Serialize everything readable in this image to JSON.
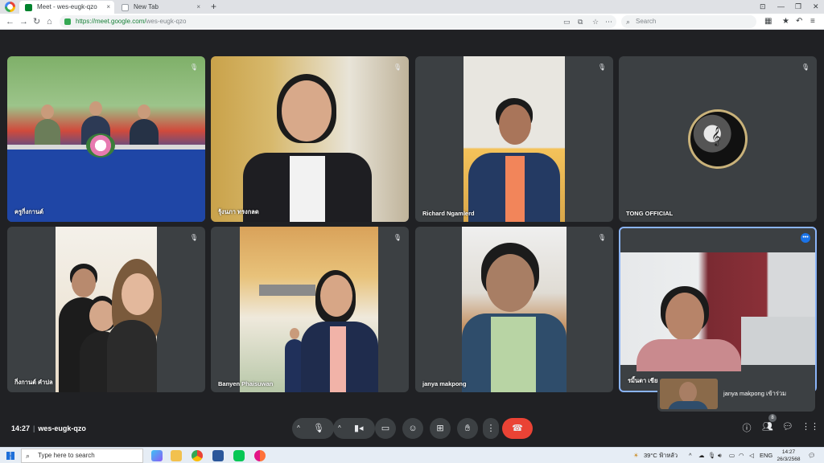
{
  "browser": {
    "tabs": [
      {
        "title": "Meet - wes-eugk-qzo",
        "close": "×"
      },
      {
        "title": "New Tab",
        "close": "×"
      }
    ],
    "new_tab": "+",
    "url_host": "https://meet.google.com/",
    "url_path": "wes-eugk-qzo",
    "search_placeholder": "Search"
  },
  "participants": [
    {
      "name": "ครูกิ่งกานต์",
      "muted": true
    },
    {
      "name": "รุ้งนภา ทรงกลด",
      "muted": true
    },
    {
      "name": "Richard Ngamlerd",
      "muted": true
    },
    {
      "name": "TONG OFFICIAL",
      "muted": true
    },
    {
      "name": "กิ่งกานต์ คำปล",
      "muted": true
    },
    {
      "name": "Banyen Phaisuwan",
      "muted": true
    },
    {
      "name": "janya makpong",
      "muted": true
    },
    {
      "name": "รมิ้นตา เขียวอ่",
      "muted": false
    }
  ],
  "toast": {
    "text": "janya makpong เข้าร่วม"
  },
  "meeting": {
    "time": "14:27",
    "code": "wes-eugk-qzo",
    "people_count": "8"
  },
  "taskbar": {
    "search_placeholder": "Type here to search",
    "weather": "39°C  ฟ้าหลัว",
    "lang": "ENG",
    "time": "14:27",
    "date": "26/3/2568"
  },
  "colors": {
    "end_call": "#ea4335",
    "meet_bg": "#202124",
    "tile_bg": "#3c4043",
    "active_border": "#8ab4f8"
  }
}
